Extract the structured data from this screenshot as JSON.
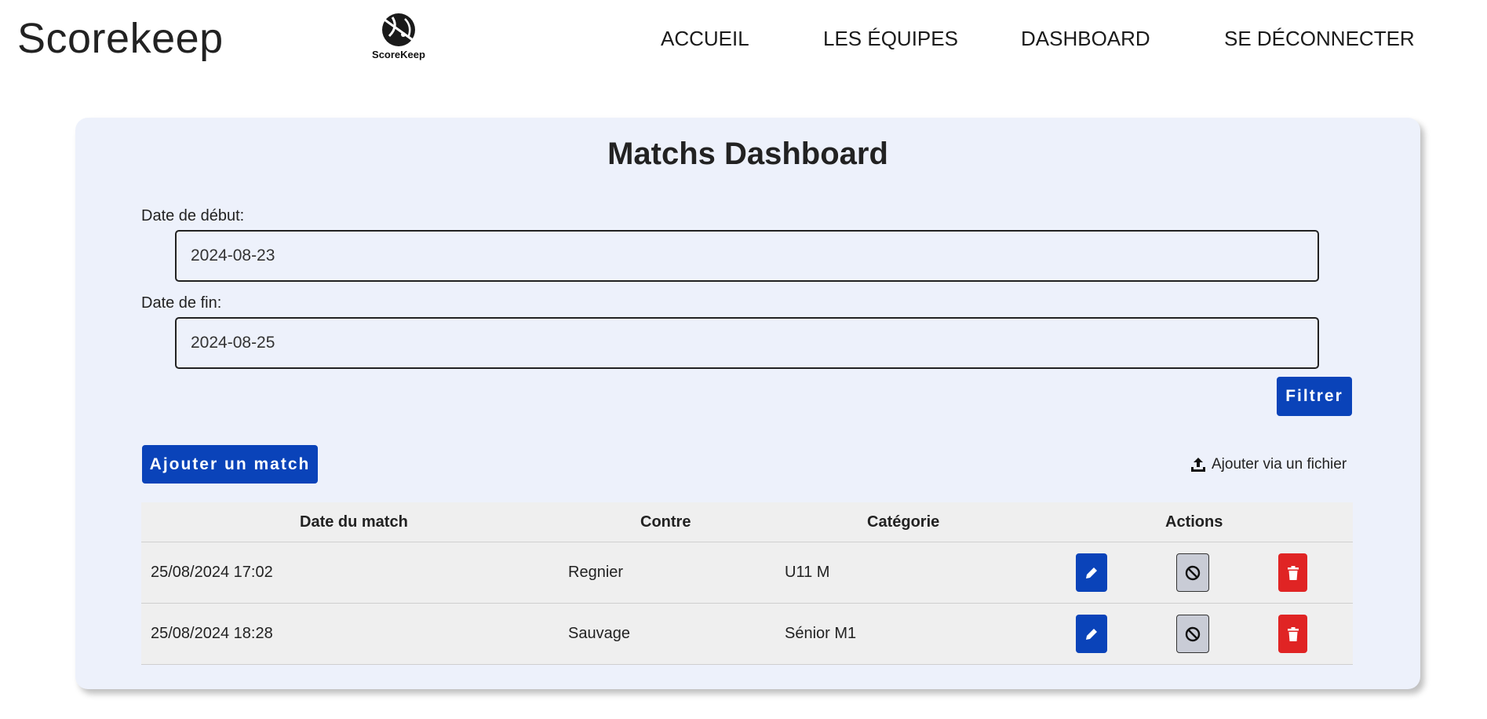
{
  "header": {
    "brand": "Scorekeep",
    "logo_text": "ScoreKeep",
    "nav": {
      "home": "ACCUEIL",
      "teams": "LES ÉQUIPES",
      "dashboard": "DASHBOARD",
      "logout": "SE DÉCONNECTER"
    }
  },
  "dashboard": {
    "title": "Matchs Dashboard",
    "start_label": "Date de début:",
    "start_value": "2024-08-23",
    "end_label": "Date de fin:",
    "end_value": "2024-08-25",
    "filter_button": "Filtrer",
    "add_match_button": "Ajouter un match",
    "upload_link": "Ajouter via un fichier"
  },
  "table": {
    "headers": {
      "date": "Date du match",
      "contre": "Contre",
      "categorie": "Catégorie",
      "actions": "Actions"
    },
    "rows": [
      {
        "date": "25/08/2024 17:02",
        "contre": "Regnier",
        "categorie": "U11 M"
      },
      {
        "date": "25/08/2024 18:28",
        "contre": "Sauvage",
        "categorie": "Sénior M1"
      }
    ]
  },
  "icons": {
    "logo": "ball-logo-icon",
    "upload": "upload-icon",
    "edit": "pencil-icon",
    "block": "ban-icon",
    "delete": "trash-icon"
  },
  "colors": {
    "primary": "#0a43b9",
    "danger": "#e02424",
    "card_bg": "#edf1fb",
    "table_bg": "#efefef"
  }
}
